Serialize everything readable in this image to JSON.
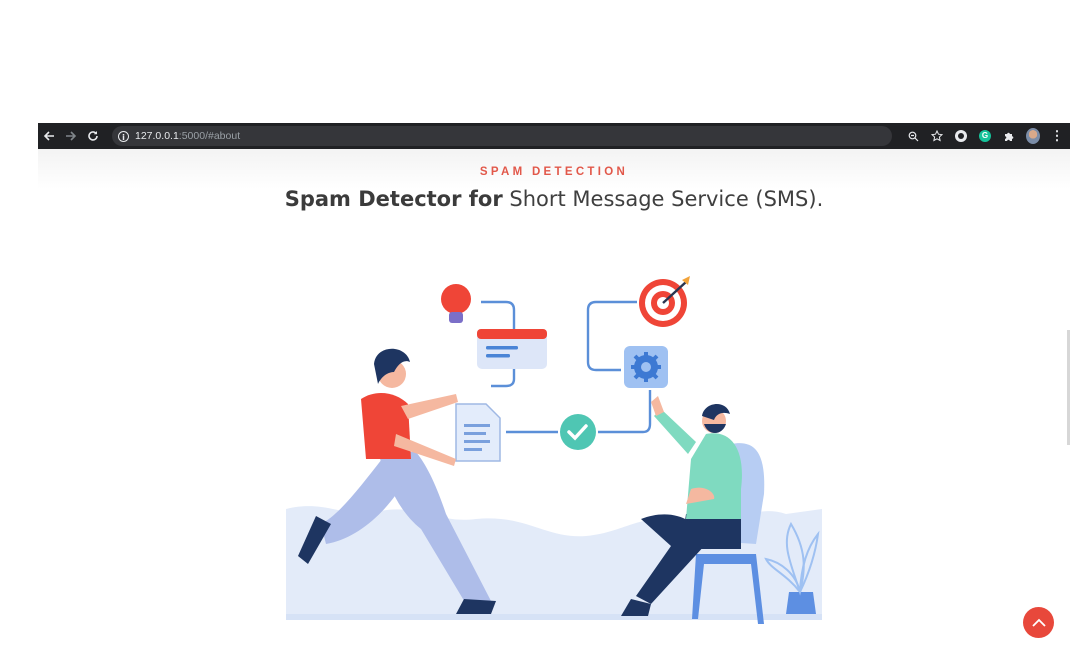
{
  "browser": {
    "url_host": "127.0.0.1",
    "url_rest": ":5000/#about"
  },
  "icons": {
    "back": "arrow-left-icon",
    "forward": "arrow-right-icon",
    "reload": "reload-icon",
    "site_info": "info-icon",
    "zoom": "zoom-icon",
    "bookmark": "star-icon",
    "menu": "kebab-icon",
    "scroll_top": "chevron-up-icon"
  },
  "about": {
    "eyebrow": "SPAM DETECTION",
    "title_bold": "Spam Detector for",
    "title_light": " Short Message Service (SMS)."
  },
  "colors": {
    "accent": "#e8483b",
    "chrome_bg": "#202124"
  }
}
